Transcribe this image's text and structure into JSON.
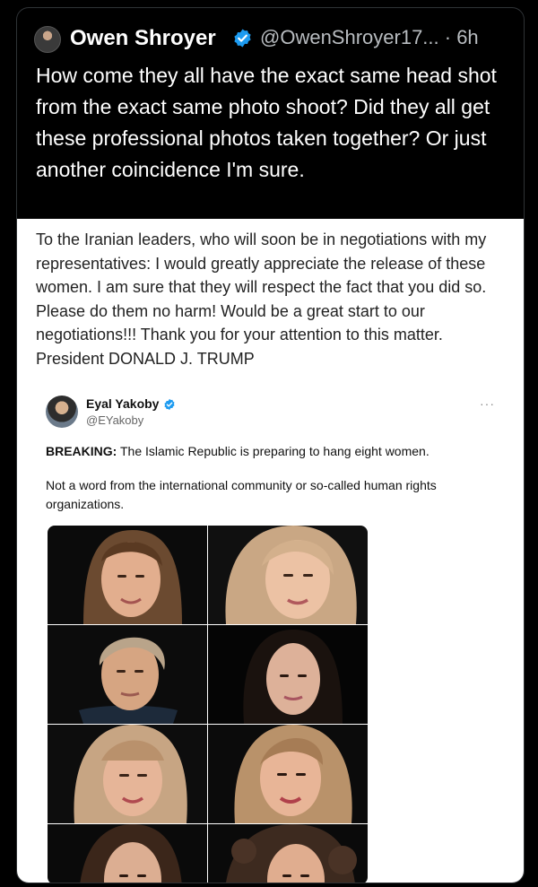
{
  "tweet": {
    "author_name": "Owen Shroyer",
    "handle_time": "@OwenShroyer17... · 6h",
    "text": "How come they all have the exact same head shot from the exact same photo shoot? Did they all get these professional photos taken together? Or just another coincidence I'm sure."
  },
  "embedded_post": {
    "text": "To the Iranian leaders, who will soon be in negotiations with my representatives: I would greatly appreciate the release of these women. I am sure that they will respect the fact that you did so. Please do them no harm! Would be a great start to our negotiations!!! Thank you for your attention to this matter. President DONALD J. TRUMP"
  },
  "quoted_post": {
    "author_name": "Eyal Yakoby",
    "handle": "@EYakoby",
    "more_label": "···",
    "breaking_label": "BREAKING:",
    "breaking_text": " The Islamic Republic is preparing to hang eight women.",
    "paragraph2": "Not a word from the international community or so-called human rights organizations."
  },
  "colors": {
    "background": "#000000",
    "verified_blue": "#1d9bf0",
    "panel_white": "#ffffff"
  },
  "icons": {
    "verified": "verified-badge-icon",
    "more": "more-dots-icon"
  }
}
